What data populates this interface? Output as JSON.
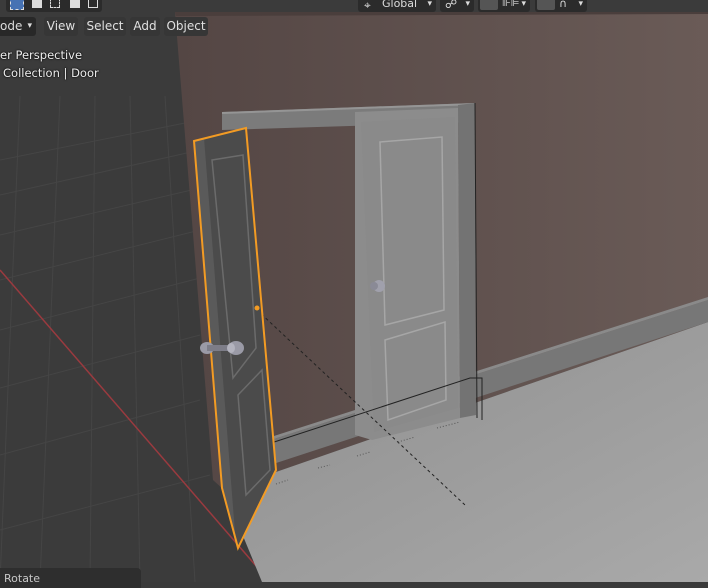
{
  "header": {
    "mode_label": "ode",
    "menus": [
      {
        "label": "View"
      },
      {
        "label": "Select"
      },
      {
        "label": "Add"
      },
      {
        "label": "Object"
      }
    ],
    "transform_orientation": "Global"
  },
  "overlay": {
    "view_name": "er Perspective",
    "collection_object": "Collection | Door"
  },
  "last_operator": {
    "label": "Rotate"
  },
  "colors": {
    "wall": "#5e4f4b",
    "floor": "#9c9c9c",
    "grid_bg": "#3c3c3c",
    "selection_outline": "#f29b24",
    "x_axis": "#9a3a3f"
  }
}
